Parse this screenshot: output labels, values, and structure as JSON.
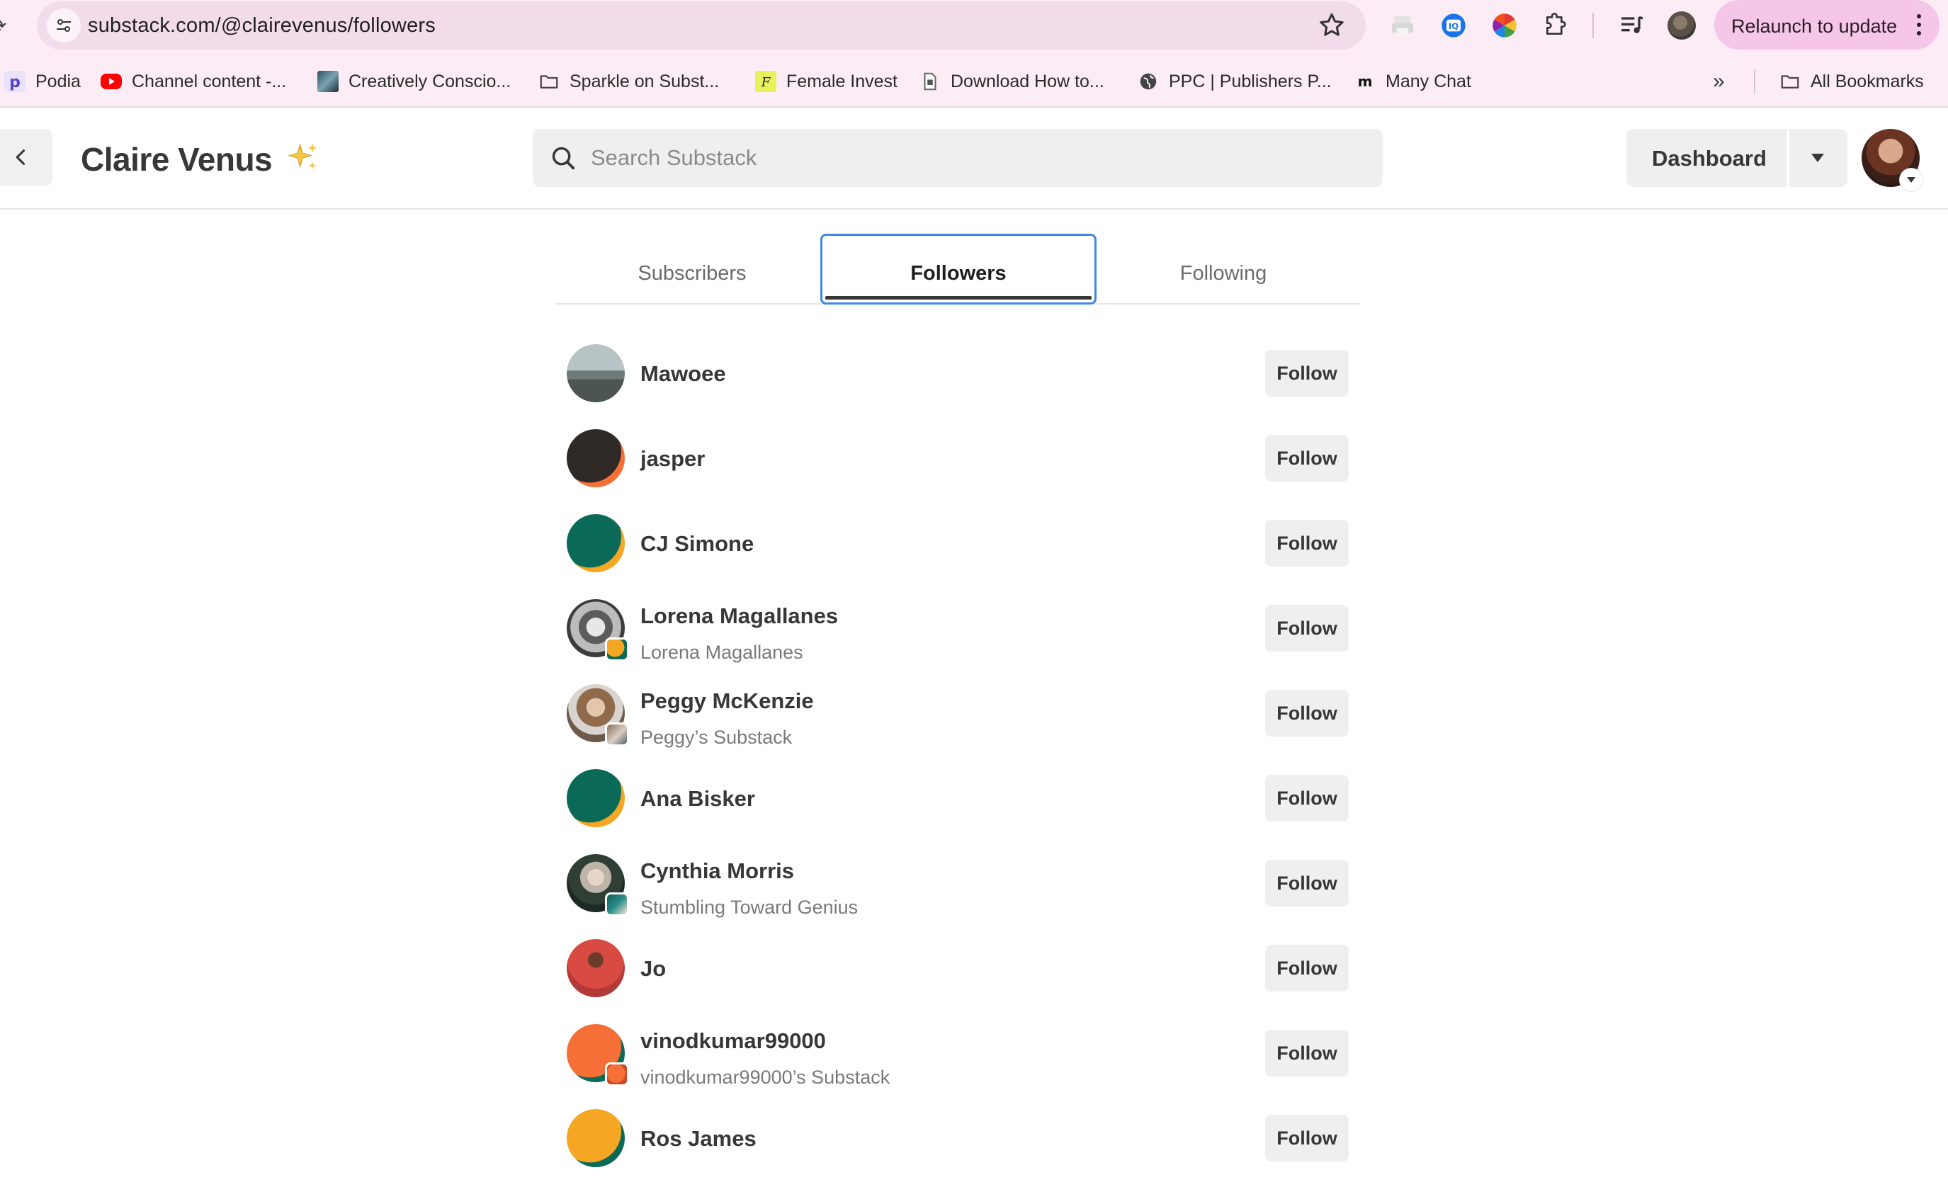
{
  "browser": {
    "url": "substack.com/@clairevenus/followers",
    "relaunch_label": "Relaunch to update",
    "bookmarks": [
      {
        "label": "Podia",
        "icon": "podia-icon",
        "color": "#5b3fd4"
      },
      {
        "label": "Channel content -...",
        "icon": "youtube-icon",
        "color": "#ff0000"
      },
      {
        "label": "Creatively Conscio...",
        "icon": "image-favicon",
        "color": "#3a6f7f"
      },
      {
        "label": "Sparkle on Subst...",
        "icon": "folder-icon",
        "color": "#444444"
      },
      {
        "label": "Female Invest",
        "icon": "female-invest-icon",
        "color": "#e6f25a"
      },
      {
        "label": "Download How to...",
        "icon": "document-icon",
        "color": "#777777"
      },
      {
        "label": "PPC | Publishers P...",
        "icon": "globe-icon",
        "color": "#444444"
      },
      {
        "label": "Many Chat",
        "icon": "manychat-icon",
        "color": "#111111"
      }
    ],
    "all_bookmarks_label": "All Bookmarks"
  },
  "header": {
    "title": "Claire Venus",
    "title_emoji": "sparkles-icon",
    "search_placeholder": "Search Substack",
    "dashboard_label": "Dashboard"
  },
  "tabs": [
    {
      "label": "Subscribers",
      "active": false
    },
    {
      "label": "Followers",
      "active": true
    },
    {
      "label": "Following",
      "active": false
    }
  ],
  "followers": [
    {
      "name": "Mawoee",
      "subtitle": "",
      "button": "Follow"
    },
    {
      "name": "jasper",
      "subtitle": "",
      "button": "Follow"
    },
    {
      "name": "CJ Simone",
      "subtitle": "",
      "button": "Follow"
    },
    {
      "name": "Lorena Magallanes",
      "subtitle": "Lorena Magallanes",
      "button": "Follow"
    },
    {
      "name": "Peggy McKenzie",
      "subtitle": "Peggy’s Substack",
      "button": "Follow"
    },
    {
      "name": "Ana Bisker",
      "subtitle": "",
      "button": "Follow"
    },
    {
      "name": "Cynthia Morris",
      "subtitle": "Stumbling Toward Genius",
      "button": "Follow"
    },
    {
      "name": "Jo",
      "subtitle": "",
      "button": "Follow"
    },
    {
      "name": "vinodkumar99000",
      "subtitle": "vinodkumar99000’s Substack",
      "button": "Follow"
    },
    {
      "name": "Ros James",
      "subtitle": "",
      "button": "Follow"
    }
  ],
  "colors": {
    "chrome_bg": "#fcecf6",
    "relaunch_bg": "#f6c6e8",
    "active_tab_outline": "#3f87e5",
    "button_bg": "#efefef",
    "text": "#363737"
  }
}
